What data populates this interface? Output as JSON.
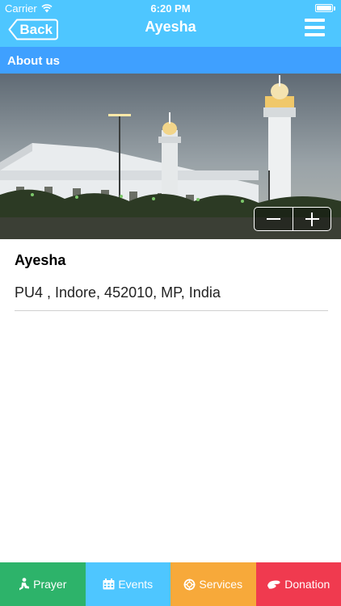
{
  "status_bar": {
    "carrier": "Carrier",
    "time": "6:20 PM"
  },
  "nav": {
    "back_label": "Back",
    "title": "Ayesha"
  },
  "section": {
    "title": "About us"
  },
  "place": {
    "name": "Ayesha",
    "address": "PU4 , Indore, 452010, MP, India"
  },
  "tabs": [
    {
      "label": "Prayer",
      "icon": "prayer-icon",
      "color": "#2db36a"
    },
    {
      "label": "Events",
      "icon": "calendar-icon",
      "color": "#4ec6ff"
    },
    {
      "label": "Services",
      "icon": "services-icon",
      "color": "#f7a93a"
    },
    {
      "label": "Donation",
      "icon": "donation-icon",
      "color": "#f03a4f"
    }
  ],
  "colors": {
    "header": "#4ec6ff",
    "section_bar": "#3fa0ff"
  }
}
